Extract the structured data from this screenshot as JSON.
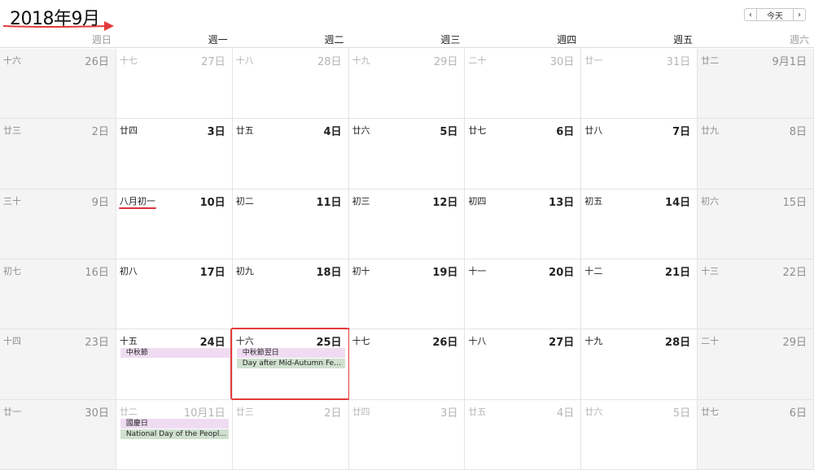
{
  "header": {
    "month_title": "2018年9月",
    "nav": {
      "prev_label": "‹",
      "today_label": "今天",
      "next_label": "›"
    }
  },
  "weekdays": [
    "週日",
    "週一",
    "週二",
    "週三",
    "週四",
    "週五",
    "週六"
  ],
  "weeks": [
    {
      "days": [
        {
          "lunar": "十六",
          "solar": "26日",
          "type": "weekend"
        },
        {
          "lunar": "十七",
          "solar": "27日",
          "type": "other"
        },
        {
          "lunar": "十八",
          "solar": "28日",
          "type": "other"
        },
        {
          "lunar": "十九",
          "solar": "29日",
          "type": "other"
        },
        {
          "lunar": "二十",
          "solar": "30日",
          "type": "other"
        },
        {
          "lunar": "廿一",
          "solar": "31日",
          "type": "other"
        },
        {
          "lunar": "廿二",
          "solar": "9月1日",
          "type": "weekend"
        }
      ]
    },
    {
      "days": [
        {
          "lunar": "廿三",
          "solar": "2日",
          "type": "weekend"
        },
        {
          "lunar": "廿四",
          "solar": "3日",
          "type": "normal"
        },
        {
          "lunar": "廿五",
          "solar": "4日",
          "type": "normal"
        },
        {
          "lunar": "廿六",
          "solar": "5日",
          "type": "normal"
        },
        {
          "lunar": "廿七",
          "solar": "6日",
          "type": "normal"
        },
        {
          "lunar": "廿八",
          "solar": "7日",
          "type": "normal"
        },
        {
          "lunar": "廿九",
          "solar": "8日",
          "type": "weekend"
        }
      ]
    },
    {
      "days": [
        {
          "lunar": "三十",
          "solar": "9日",
          "type": "weekend"
        },
        {
          "lunar": "八月初一",
          "solar": "10日",
          "type": "normal",
          "underline": true
        },
        {
          "lunar": "初二",
          "solar": "11日",
          "type": "normal"
        },
        {
          "lunar": "初三",
          "solar": "12日",
          "type": "normal"
        },
        {
          "lunar": "初四",
          "solar": "13日",
          "type": "normal"
        },
        {
          "lunar": "初五",
          "solar": "14日",
          "type": "normal"
        },
        {
          "lunar": "初六",
          "solar": "15日",
          "type": "weekend"
        }
      ]
    },
    {
      "days": [
        {
          "lunar": "初七",
          "solar": "16日",
          "type": "weekend"
        },
        {
          "lunar": "初八",
          "solar": "17日",
          "type": "normal"
        },
        {
          "lunar": "初九",
          "solar": "18日",
          "type": "normal"
        },
        {
          "lunar": "初十",
          "solar": "19日",
          "type": "normal"
        },
        {
          "lunar": "十一",
          "solar": "20日",
          "type": "normal"
        },
        {
          "lunar": "十二",
          "solar": "21日",
          "type": "normal"
        },
        {
          "lunar": "十三",
          "solar": "22日",
          "type": "weekend"
        }
      ]
    },
    {
      "days": [
        {
          "lunar": "十四",
          "solar": "23日",
          "type": "weekend"
        },
        {
          "lunar": "十五",
          "solar": "24日",
          "type": "normal",
          "events": [
            {
              "title": "中秋節",
              "color": "pink",
              "span": "wide"
            }
          ]
        },
        {
          "lunar": "十六",
          "solar": "25日",
          "type": "normal",
          "highlight": true,
          "events": [
            {
              "title": "中秋節翌日",
              "color": "pink"
            },
            {
              "title": "Day after Mid-Autumn Festival",
              "color": "green"
            }
          ]
        },
        {
          "lunar": "十七",
          "solar": "26日",
          "type": "normal"
        },
        {
          "lunar": "十八",
          "solar": "27日",
          "type": "normal"
        },
        {
          "lunar": "十九",
          "solar": "28日",
          "type": "normal"
        },
        {
          "lunar": "二十",
          "solar": "29日",
          "type": "weekend"
        }
      ]
    },
    {
      "days": [
        {
          "lunar": "廿一",
          "solar": "30日",
          "type": "weekend"
        },
        {
          "lunar": "廿二",
          "solar": "10月1日",
          "type": "other",
          "events": [
            {
              "title": "國慶日",
              "color": "pink"
            },
            {
              "title": "National Day of the People's Republic of China",
              "color": "green"
            }
          ]
        },
        {
          "lunar": "廿三",
          "solar": "2日",
          "type": "other"
        },
        {
          "lunar": "廿四",
          "solar": "3日",
          "type": "other"
        },
        {
          "lunar": "廿五",
          "solar": "4日",
          "type": "other"
        },
        {
          "lunar": "廿六",
          "solar": "5日",
          "type": "other"
        },
        {
          "lunar": "廿七",
          "solar": "6日",
          "type": "weekend"
        }
      ]
    }
  ]
}
